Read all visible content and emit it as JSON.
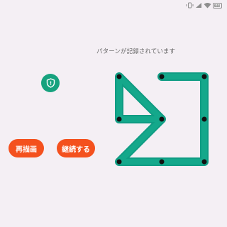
{
  "status_bar": {
    "battery_level": "85",
    "icons": [
      "vibrate-icon",
      "signal-icon",
      "wifi-icon",
      "battery-icon"
    ]
  },
  "lock_icon": "shield-lock-icon",
  "pattern_status": "パターンが記録されています",
  "buttons": {
    "redraw": "再描画",
    "continue": "継続する"
  },
  "colors": {
    "background": "#f4eff4",
    "accent": "#16a27e",
    "pattern_line": "#0f9c83",
    "button": "#f4511e"
  }
}
